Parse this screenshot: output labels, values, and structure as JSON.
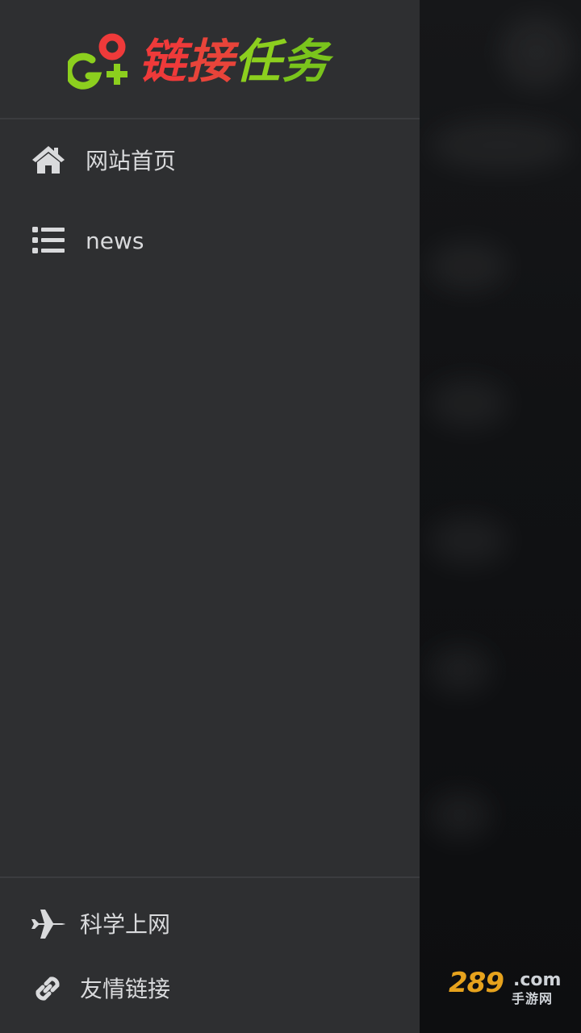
{
  "logo": {
    "icon_name": "link-task-logo-icon",
    "text_parts": [
      "链",
      "接",
      "任",
      "务"
    ],
    "colors": [
      "#ef3a3a",
      "#e8443a",
      "#8ccf1e",
      "#7ac41c"
    ]
  },
  "nav": {
    "items": [
      {
        "label": "网站首页",
        "icon": "home-icon"
      },
      {
        "label": "news",
        "icon": "list-icon"
      }
    ]
  },
  "footer": {
    "items": [
      {
        "label": "科学上网",
        "icon": "airplane-icon"
      },
      {
        "label": "友情链接",
        "icon": "link-icon"
      }
    ]
  },
  "watermark": {
    "main": "289",
    "com": ".com",
    "sub": "手游网"
  },
  "colors": {
    "drawer_bg": "#2e2f31",
    "text": "#d9dadc",
    "icon": "#d9dadc",
    "accent_red": "#ef3a3a",
    "accent_green": "#8ccf1e"
  }
}
